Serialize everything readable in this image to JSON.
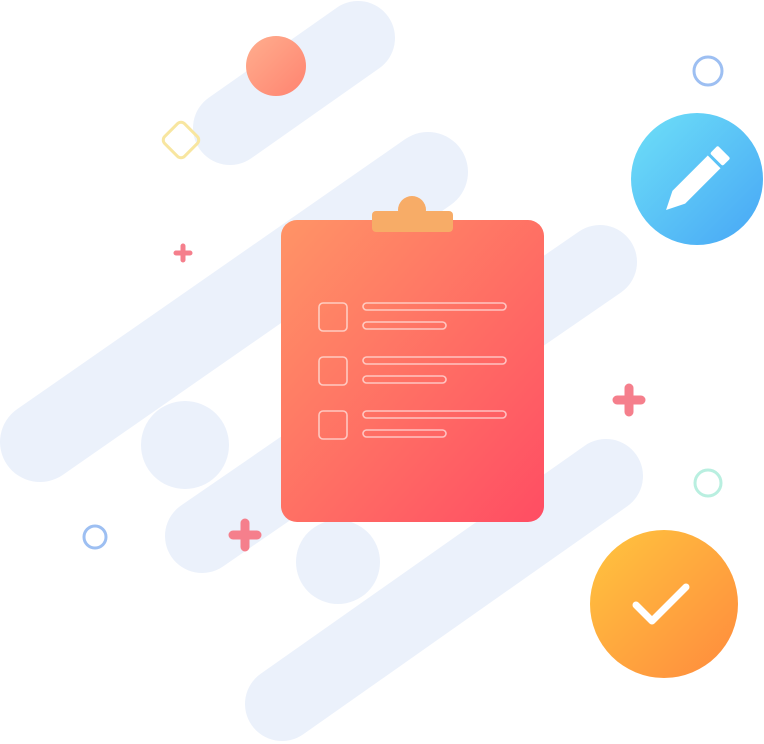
{
  "illustration": {
    "subject": "clipboard-checklist",
    "checklist": {
      "rows": [
        {
          "checked": false
        },
        {
          "checked": false
        },
        {
          "checked": false
        }
      ]
    },
    "icons": [
      "clipboard-icon",
      "pencil-icon",
      "checkmark-icon"
    ],
    "colors": {
      "background": "#ffffff",
      "backdrop_shapes": "#ebf1fb",
      "clipboard_start": "#ff9466",
      "clipboard_end": "#ff4d63",
      "clip": "#f7ac67",
      "pencil_badge_start": "#6ee0f7",
      "pencil_badge_end": "#47a6f6",
      "check_badge_start": "#ffc53f",
      "check_badge_end": "#ff8a3d",
      "plus_accent": "#f57f8c",
      "ring_blue": "#9dbff2",
      "ring_mint": "#b9efe0",
      "diamond_yellow": "#f8e6a0",
      "top_circle_start": "#ffae8e",
      "top_circle_end": "#ff8370"
    }
  }
}
